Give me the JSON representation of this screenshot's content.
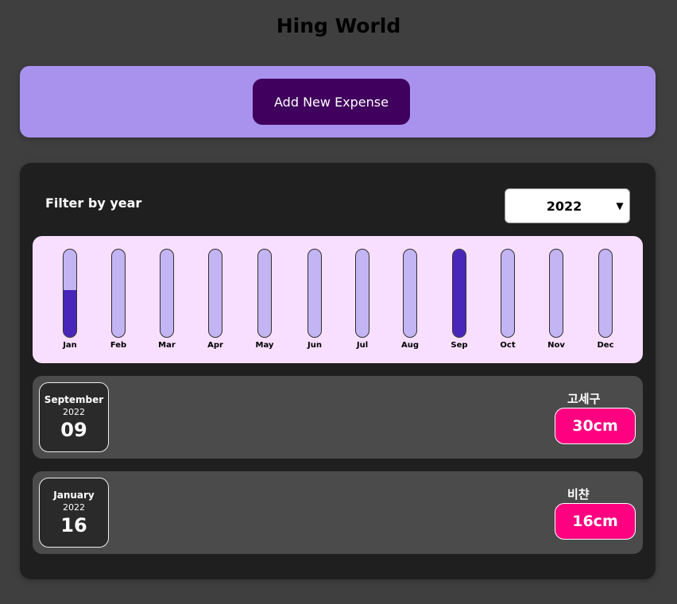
{
  "header": {
    "title": "Hing World"
  },
  "new_expense": {
    "button_label": "Add New Expense"
  },
  "filter": {
    "label": "Filter by year",
    "selected_year": "2022"
  },
  "chart_data": {
    "type": "bar",
    "categories": [
      "Jan",
      "Feb",
      "Mar",
      "Apr",
      "May",
      "Jun",
      "Jul",
      "Aug",
      "Sep",
      "Oct",
      "Nov",
      "Dec"
    ],
    "values": [
      16,
      0,
      0,
      0,
      0,
      0,
      0,
      0,
      30,
      0,
      0,
      0
    ],
    "max_value": 30
  },
  "expenses": [
    {
      "month": "September",
      "year": "2022",
      "day": "09",
      "title": "고세구",
      "amount": "30cm"
    },
    {
      "month": "January",
      "year": "2022",
      "day": "16",
      "title": "비챤",
      "amount": "16cm"
    }
  ],
  "colors": {
    "background": "#3f3f3f",
    "new_expense_panel": "#a892ee",
    "button": "#40005d",
    "chart_bg": "#f8dfff",
    "bar_track": "#c3b4f3",
    "bar_fill": "#4826b9",
    "price_badge": "#ff0080"
  }
}
